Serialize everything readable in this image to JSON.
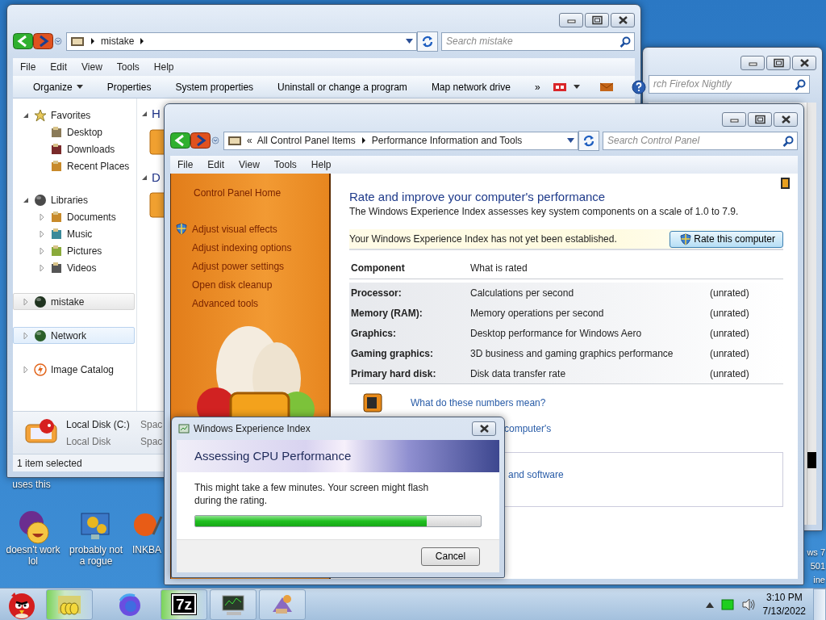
{
  "explorer": {
    "address": [
      "mistake"
    ],
    "search": {
      "placeholder": "Search mistake"
    },
    "menu": [
      "File",
      "Edit",
      "View",
      "Tools",
      "Help"
    ],
    "toolbar": [
      {
        "label": "Organize",
        "kind": "dropdown"
      },
      {
        "label": "Properties",
        "kind": "command"
      },
      {
        "label": "System properties",
        "kind": "command"
      },
      {
        "label": "Uninstall or change a program",
        "kind": "command"
      },
      {
        "label": "Map network drive",
        "kind": "command"
      }
    ],
    "toolbar_overflow": "»",
    "nav": [
      {
        "label": "Favorites",
        "expanded": true,
        "selected": false,
        "hovered": false,
        "children": [
          {
            "label": "Desktop"
          },
          {
            "label": "Downloads"
          },
          {
            "label": "Recent Places"
          }
        ]
      },
      {
        "label": "Libraries",
        "expanded": true,
        "selected": false,
        "hovered": false,
        "children": [
          {
            "label": "Documents",
            "expanded": false
          },
          {
            "label": "Music",
            "expanded": false
          },
          {
            "label": "Pictures",
            "expanded": false
          },
          {
            "label": "Videos",
            "expanded": false
          }
        ]
      },
      {
        "label": "mistake",
        "expanded": false,
        "selected": true,
        "hovered": false
      },
      {
        "label": "Network",
        "expanded": false,
        "selected": false,
        "hovered": true
      },
      {
        "label": "Image Catalog",
        "expanded": false,
        "selected": false,
        "hovered": false
      }
    ],
    "groups": [
      "H",
      "D"
    ],
    "details": {
      "name": "Local Disk (C:)",
      "type": "Local Disk",
      "labels": [
        "Spac",
        "Spac"
      ]
    },
    "status_bar": "1 item selected"
  },
  "back_window": {
    "search": {
      "placeholder": "rch Firefox Nightly"
    }
  },
  "control_panel": {
    "breadcrumb_overflow": "«",
    "breadcrumb": [
      "All Control Panel Items",
      "Performance Information and Tools"
    ],
    "search": {
      "placeholder": "Search Control Panel"
    },
    "menu": [
      "File",
      "Edit",
      "View",
      "Tools",
      "Help"
    ],
    "sidebar": {
      "home": "Control Panel Home",
      "links": [
        {
          "label": "Adjust visual effects",
          "kind": "admin"
        },
        {
          "label": "Adjust indexing options",
          "kind": "plain"
        },
        {
          "label": "Adjust power settings",
          "kind": "plain"
        },
        {
          "label": "Open disk cleanup",
          "kind": "plain"
        },
        {
          "label": "Advanced tools",
          "kind": "plain"
        }
      ]
    },
    "heading": "Rate and improve your computer's performance",
    "intro": "The Windows Experience Index assesses key system components on a scale of 1.0 to 7.9.",
    "notice": "Your Windows Experience Index has not yet been established.",
    "rate_button": "Rate this computer",
    "table": {
      "columns": [
        "Component",
        "What is rated"
      ],
      "rows": [
        {
          "component": "Processor:",
          "rated": "Calculations per second",
          "score": "(unrated)"
        },
        {
          "component": "Memory (RAM):",
          "rated": "Memory operations per second",
          "score": "(unrated)"
        },
        {
          "component": "Graphics:",
          "rated": "Desktop performance for Windows Aero",
          "score": "(unrated)"
        },
        {
          "component": "Gaming graphics:",
          "rated": "3D business and gaming graphics performance",
          "score": "(unrated)"
        },
        {
          "component": "Primary hard disk:",
          "rated": "Disk data transfer rate",
          "score": "(unrated)"
        }
      ]
    },
    "links": [
      "What do these numbers mean?",
      "computer's"
    ],
    "box_link": "and software"
  },
  "dialog": {
    "title": "Windows Experience Index",
    "banner": "Assessing CPU Performance",
    "message": "This might take a few minutes. Your screen might flash during the rating.",
    "progress": {
      "level": 0.81
    },
    "button": "Cancel"
  },
  "desktop_icons": [
    {
      "label": "uses this"
    },
    {
      "label": "doesn't work lol"
    },
    {
      "label": "probably not a rogue"
    },
    {
      "label": "INKBA"
    }
  ],
  "desktop_text": [
    "ws 7",
    "501",
    "ine"
  ],
  "taskbar": {
    "buttons": [
      {
        "kind": "folder",
        "active": true
      },
      {
        "kind": "browser",
        "active": false
      },
      {
        "kind": "archiver",
        "glyph": "7z",
        "active": true
      },
      {
        "kind": "monitor",
        "active": false
      },
      {
        "kind": "artwork",
        "active": false
      }
    ]
  },
  "clock": {
    "time": "3:10 PM",
    "date": "7/13/2022"
  }
}
